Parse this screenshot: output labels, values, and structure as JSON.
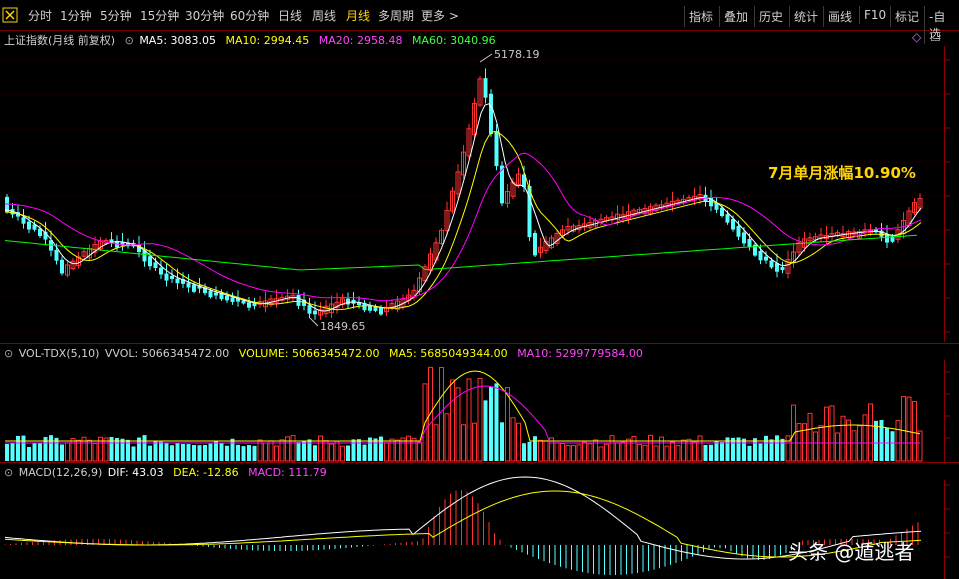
{
  "toolbar": {
    "periods": [
      "分时",
      "1分钟",
      "5分钟",
      "15分钟",
      "30分钟",
      "60分钟",
      "日线",
      "周线",
      "月线",
      "多周期",
      "更多 >"
    ],
    "active_period": "月线",
    "tools": [
      "指标",
      "叠加",
      "历史",
      "统计",
      "画线",
      "F10",
      "标记",
      "-自选"
    ]
  },
  "price_panel": {
    "title": "上证指数(月线 前复权)",
    "ma5": "MA5: 3083.05",
    "ma10": "MA10: 2994.45",
    "ma20": "MA20: 2958.48",
    "ma60": "MA60: 3040.96",
    "high_label": "5178.19",
    "low_label": "1849.65",
    "annotation": "7月单月涨幅10.90%"
  },
  "volume_panel": {
    "title": "VOL-TDX(5,10)",
    "vvol": "VVOL: 5066345472.00",
    "volume": "VOLUME: 5066345472.00",
    "ma5": "MA5: 5685049344.00",
    "ma10": "MA10: 5299779584.00"
  },
  "macd_panel": {
    "title": "MACD(12,26,9)",
    "dif": "DIF: 43.03",
    "dea": "DEA: -12.86",
    "macd": "MACD: 111.79"
  },
  "watermark": "头条 @遁逃者",
  "colors": {
    "up": "#ff3232",
    "down": "#54ffff",
    "ma5": "#ffffff",
    "ma10": "#ffff00",
    "ma20": "#ff00ff",
    "ma60": "#00ff00",
    "annotation": "#ffd400"
  },
  "icons": [
    "toolbar-logo-icon",
    "pane-toggle-icon",
    "diamond-icon",
    "gear-icon",
    "close-icon"
  ]
}
